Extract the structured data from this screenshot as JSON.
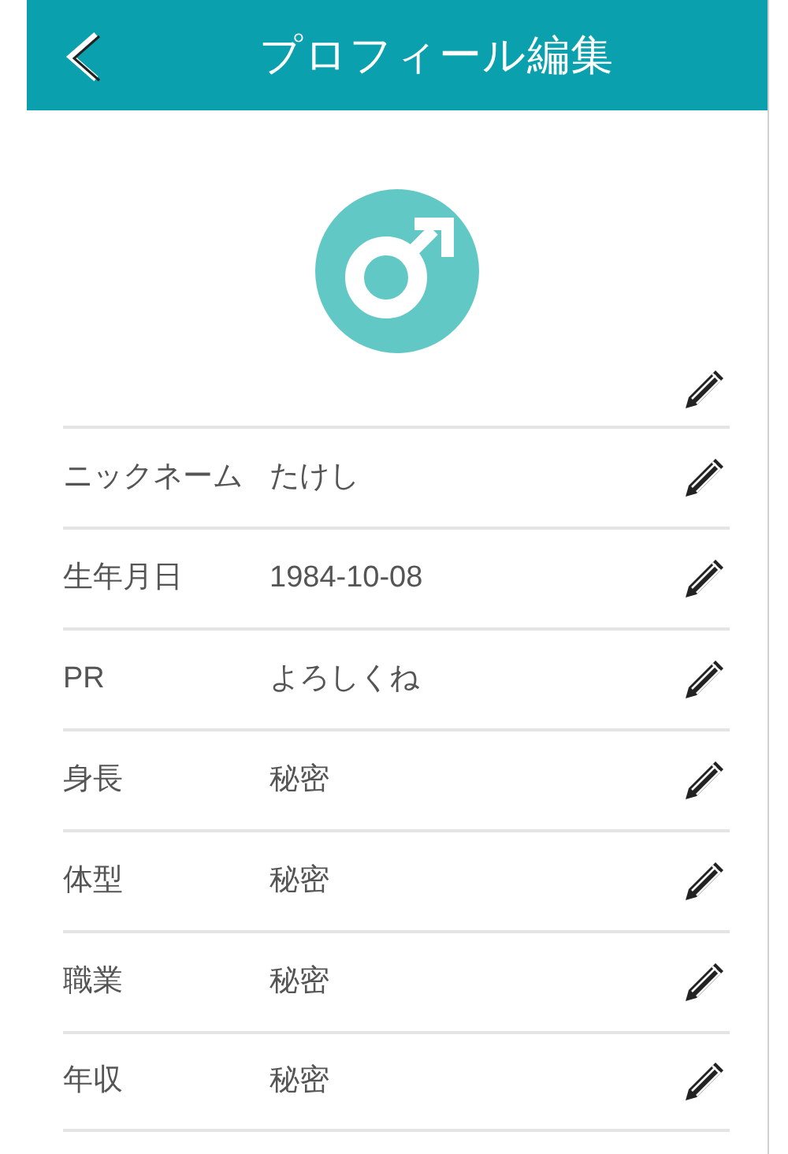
{
  "header": {
    "title": "プロフィール編集"
  },
  "fields": [
    {
      "label": "ニックネーム",
      "value": "たけし"
    },
    {
      "label": "生年月日",
      "value": "1984-10-08"
    },
    {
      "label": "PR",
      "value": "よろしくね"
    },
    {
      "label": "身長",
      "value": "秘密"
    },
    {
      "label": "体型",
      "value": "秘密"
    },
    {
      "label": "職業",
      "value": "秘密"
    },
    {
      "label": "年収",
      "value": "秘密"
    }
  ]
}
